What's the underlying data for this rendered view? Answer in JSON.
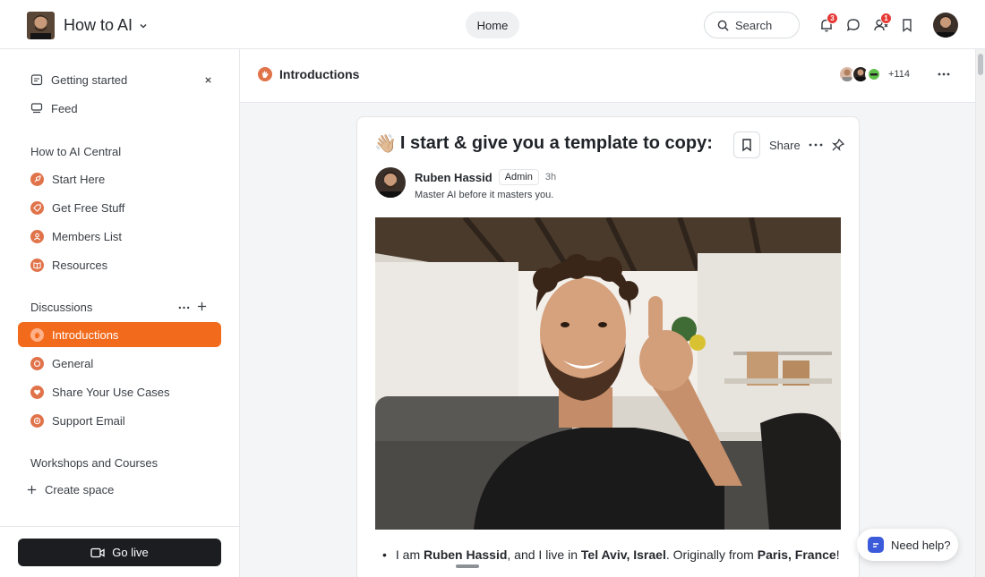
{
  "app": {
    "title": "How to AI"
  },
  "header": {
    "home_label": "Home",
    "search_label": "Search",
    "notifications_count": "3",
    "dms_count": "1"
  },
  "sidebar": {
    "top_items": [
      {
        "label": "Getting started",
        "icon": "calendar-icon"
      },
      {
        "label": "Feed",
        "icon": "feed-icon"
      }
    ],
    "sections": [
      {
        "title": "How to AI Central",
        "items": [
          {
            "label": "Start Here",
            "icon": "rocket-icon"
          },
          {
            "label": "Get Free Stuff",
            "icon": "tag-icon"
          },
          {
            "label": "Members List",
            "icon": "users-icon"
          },
          {
            "label": "Resources",
            "icon": "book-icon"
          }
        ]
      },
      {
        "title": "Discussions",
        "items": [
          {
            "label": "Introductions",
            "icon": "wave-icon",
            "active": true
          },
          {
            "label": "General",
            "icon": "chat-icon"
          },
          {
            "label": "Share Your Use Cases",
            "icon": "heart-icon"
          },
          {
            "label": "Support Email",
            "icon": "lifebuoy-icon"
          }
        ]
      },
      {
        "title": "Workshops and Courses",
        "items": []
      }
    ],
    "create_space_label": "Create space",
    "go_live_label": "Go live"
  },
  "channel": {
    "title": "Introductions",
    "member_count": "+114"
  },
  "post": {
    "emoji": "👋🏼",
    "title": "I start & give you a template to copy:",
    "share_label": "Share",
    "author": "Ruben Hassid",
    "author_badge": "Admin",
    "time": "3h",
    "author_tagline": "Master AI before it masters you.",
    "body": {
      "t1": "I am ",
      "name": "Ruben Hassid",
      "t2": ", and I live in ",
      "city": "Tel Aviv, Israel",
      "t3": ". Originally from ",
      "origin": "Paris, France",
      "t4": "!"
    }
  },
  "help_label": "Need help?",
  "colors": {
    "accent": "#f26b1d",
    "icon_orange": "#e0734a",
    "badge_red": "#e53935",
    "go_live_bg": "#1b1d21"
  }
}
